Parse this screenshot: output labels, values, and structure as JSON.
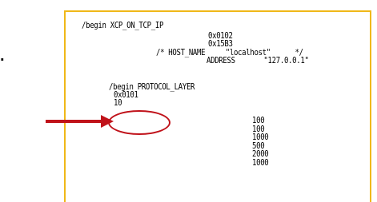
{
  "page": {
    "edge_glyph": "."
  },
  "document": {
    "lines": [
      "/begin XCP_ON_TCP_IP",
      "0x0102",
      "0x15B3",
      "/* HOST_NAME     \"localhost\"      */",
      "ADDRESS       \"127.0.0.1\"",
      "/begin PROTOCOL_LAYER",
      "0x0101",
      "10",
      "100",
      "100",
      "1000",
      "500",
      "2000",
      "1000"
    ]
  },
  "annotation": {
    "arrow_color": "#c0121a",
    "ellipse_color": "#c0121a",
    "frame_color": "#f0b818"
  }
}
